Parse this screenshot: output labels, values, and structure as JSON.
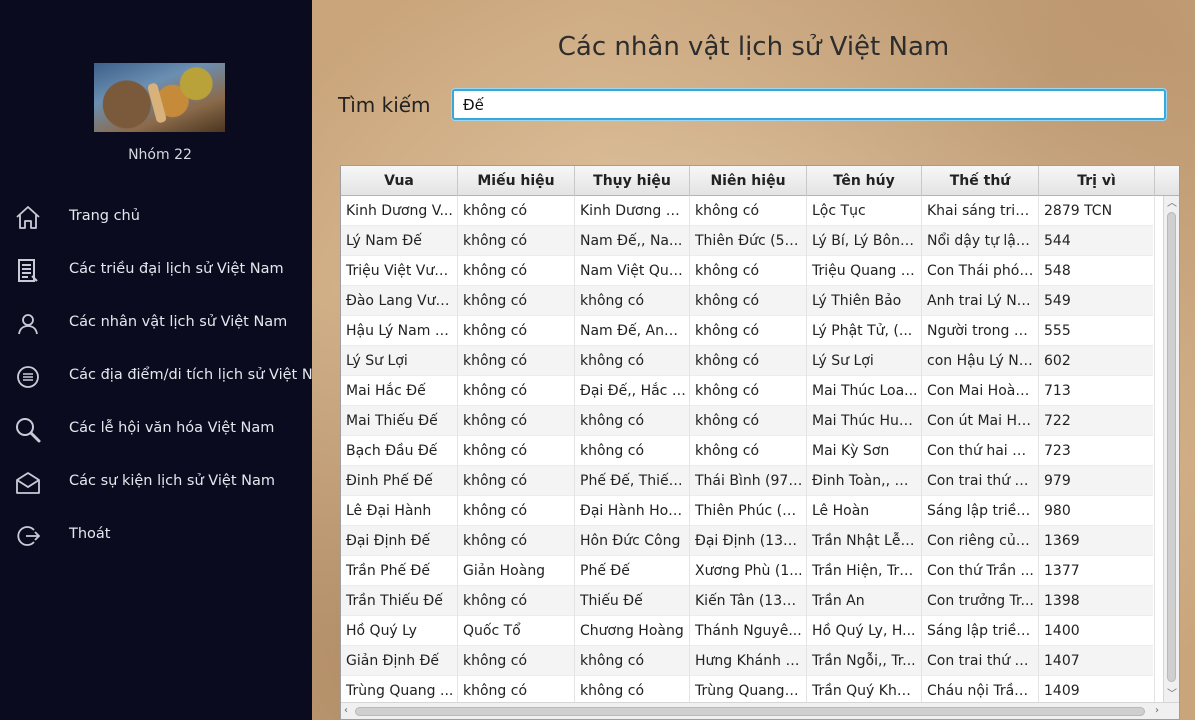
{
  "sidebar": {
    "group_name": "Nhóm 22",
    "items": [
      {
        "label": "Trang chủ",
        "icon": "home-icon"
      },
      {
        "label": "Các triều đại lịch sử Việt Nam",
        "icon": "document-list-icon"
      },
      {
        "label": "Các nhân vật lịch sử Việt Nam",
        "icon": "person-icon"
      },
      {
        "label": "Các địa điểm/di tích lịch sử Việt Nam",
        "icon": "list-circle-icon"
      },
      {
        "label": "Các lễ hội văn hóa Việt Nam",
        "icon": "search-icon"
      },
      {
        "label": "Các sự kiện lịch sử Việt Nam",
        "icon": "mail-icon"
      },
      {
        "label": "Thoát",
        "icon": "logout-icon"
      }
    ]
  },
  "main": {
    "title": "Các nhân vật lịch sử Việt Nam",
    "search": {
      "label": "Tìm kiếm",
      "value": "Đế"
    },
    "table": {
      "columns": [
        "Vua",
        "Miếu hiệu",
        "Thụy hiệu",
        "Niên hiệu",
        "Tên húy",
        "Thế thứ",
        "Trị vì"
      ],
      "rows": [
        [
          "Kinh Dương V...",
          "không có",
          "Kinh Dương V...",
          "không có",
          "Lộc Tục",
          "Khai sáng triề...",
          "2879 TCN"
        ],
        [
          "Lý Nam Đế",
          "không có",
          "Nam Đế,, Na...",
          "Thiên Đức (54...",
          "Lý Bí,  Lý Bôn, ...",
          "Nổi dậy tự lập...",
          "544"
        ],
        [
          "Triệu Việt Vươ...",
          "không có",
          "Nam Việt Quố...",
          "không có",
          "Triệu Quang P...",
          "Con Thái phó ...",
          "548"
        ],
        [
          "Đào Lang Vươ...",
          "không có",
          "không có",
          "không có",
          "Lý Thiên Bảo",
          "Anh trai Lý Na...",
          "549"
        ],
        [
          "Hậu Lý Nam Đế",
          "không có",
          "Nam Đế, Anh ...",
          "không có",
          "Lý Phật Tử, (...",
          "Người trong h...",
          "555"
        ],
        [
          "Lý Sư Lợi",
          "không có",
          "không có",
          "không có",
          "Lý Sư Lợi",
          "con Hậu Lý Na...",
          "602"
        ],
        [
          "Mai Hắc Đế",
          "không có",
          "Đại Đế,, Hắc Đế",
          "không có",
          "Mai Thúc Loa...",
          "Con Mai Hoàn...",
          "713"
        ],
        [
          "Mai Thiếu Đế",
          "không có",
          "không có",
          "không có",
          "Mai Thúc Huy,...",
          "Con út Mai Hắ...",
          "722"
        ],
        [
          "Bạch Đầu Đế",
          "không có",
          "không có",
          "không có",
          "Mai Kỳ Sơn",
          "Con thứ hai M...",
          "723"
        ],
        [
          "Đinh Phế Đế",
          "không có",
          "Phế Đế, Thiếu...",
          "Thái Bình (979...",
          "Đinh Toàn,, Đi...",
          "Con trai thứ 2 ...",
          "979"
        ],
        [
          "Lê Đại Hành",
          "không có",
          "Đại Hành Hoà...",
          "Thiên Phúc (9...",
          "Lê Hoàn",
          "Sáng lập triều ...",
          "980"
        ],
        [
          "Đại Định Đế",
          "không có",
          "Hôn Đức Công",
          "Đại Định (136...",
          "Trần Nhật Lễ, ...",
          "Con riêng của ...",
          "1369"
        ],
        [
          "Trần Phế Đế",
          "Giản Hoàng",
          "Phế Đế",
          "Xương Phù (1...",
          "Trần Hiện, Trầ...",
          "Con thứ Trần ...",
          "1377"
        ],
        [
          "Trần Thiếu Đế",
          "không có",
          "Thiếu Đế",
          "Kiến Tân (139...",
          "Trần An",
          "Con trưởng Tr...",
          "1398"
        ],
        [
          "Hồ Quý Ly",
          "Quốc Tổ",
          "Chương Hoàng",
          "Thánh Nguyê...",
          "Hồ Quý Ly, H...",
          "Sáng lập triều ...",
          "1400"
        ],
        [
          "Giản Định Đế",
          "không có",
          "không có",
          "Hưng Khánh (...",
          "Trần Ngỗi,, Tr...",
          "Con trai thứ Tr...",
          "1407"
        ],
        [
          "Trùng Quang ...",
          "không có",
          "không có",
          "Trùng Quang (...",
          "Trần Quý Kho...",
          "Cháu nội Trần ...",
          "1409"
        ]
      ]
    }
  },
  "colors": {
    "sidebar_bg": "#0a0b1e",
    "accent": "#3aa7d9"
  }
}
